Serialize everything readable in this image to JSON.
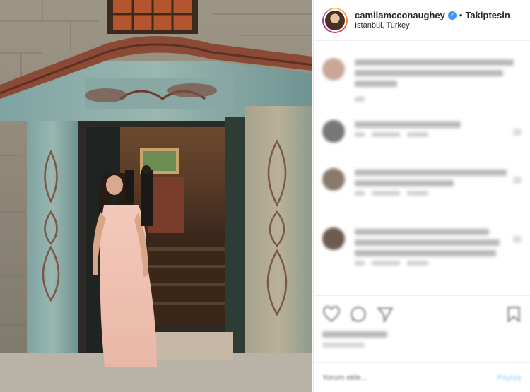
{
  "post": {
    "username": "camilamcconaughey",
    "verified_icon": "verified-badge-icon",
    "separator": "•",
    "follow_label": "Takiptesin",
    "location": "Istanbul, Turkey"
  },
  "comment_input": {
    "placeholder": "Yorum ekle...",
    "post_label": "Paylaş"
  },
  "colors": {
    "accent": "#3897f0",
    "border": "#efefef",
    "text": "#262626"
  }
}
